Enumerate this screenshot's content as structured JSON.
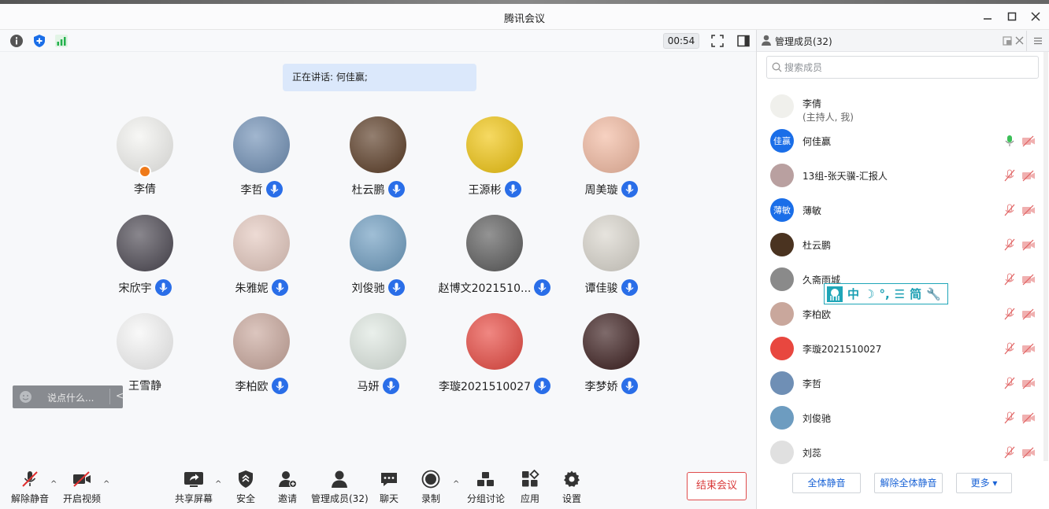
{
  "window": {
    "title": "腾讯会议"
  },
  "meeting": {
    "timer": "00:54",
    "speaking_label": "正在讲话: 何佳赢;"
  },
  "participants": [
    {
      "name": "李倩",
      "mic": false,
      "host": true,
      "avatar_color": "#f3f3f0"
    },
    {
      "name": "李哲",
      "mic": true,
      "avatar_color": "#6f8fb5"
    },
    {
      "name": "杜云鹏",
      "mic": true,
      "avatar_color": "#5a3b24"
    },
    {
      "name": "王源彬",
      "mic": true,
      "avatar_color": "#f1c50e"
    },
    {
      "name": "周美璇",
      "mic": true,
      "avatar_color": "#f2b9a0"
    },
    {
      "name": "宋欣宇",
      "mic": true,
      "avatar_color": "#4a4650"
    },
    {
      "name": "朱雅妮",
      "mic": true,
      "avatar_color": "#e4c8be"
    },
    {
      "name": "刘俊驰",
      "mic": true,
      "avatar_color": "#6d9cc0"
    },
    {
      "name": "赵博文2021510...",
      "mic": true,
      "avatar_color": "#5a5a5a"
    },
    {
      "name": "谭佳骏",
      "mic": true,
      "avatar_color": "#d9d5cc"
    },
    {
      "name": "王雪静",
      "mic": false,
      "avatar_color": "#f6f6f6"
    },
    {
      "name": "李柏欧",
      "mic": true,
      "avatar_color": "#c9a79c"
    },
    {
      "name": "马妍",
      "mic": true,
      "avatar_color": "#dfe8e1"
    },
    {
      "name": "李璇2021510027",
      "mic": true,
      "avatar_color": "#e8473f"
    },
    {
      "name": "李梦娇",
      "mic": true,
      "avatar_color": "#3a1c1c"
    }
  ],
  "chat": {
    "placeholder": "说点什么...",
    "collapse": "<"
  },
  "toolbar": {
    "unmute": "解除静音",
    "start_video": "开启视频",
    "share_screen": "共享屏幕",
    "security": "安全",
    "invite": "邀请",
    "manage_members": "管理成员(32)",
    "chat": "聊天",
    "record": "录制",
    "breakout": "分组讨论",
    "apps": "应用",
    "settings": "设置",
    "end_meeting": "结束会议"
  },
  "panel": {
    "title": "管理成员(32)",
    "search_placeholder": "搜索成员",
    "members": [
      {
        "name": "李倩",
        "sub": "(主持人, 我)",
        "avatar_color": "#f0f0ec",
        "initials": ""
      },
      {
        "name": "何佳赢",
        "avatar_color": "#1a6ee8",
        "initials": "佳赢",
        "mic_active": true
      },
      {
        "name": "13组-张天骥-汇报人",
        "avatar_color": "#b9a0a0",
        "initials": ""
      },
      {
        "name": "薄敏",
        "avatar_color": "#1a6ee8",
        "initials": "薄敏"
      },
      {
        "name": "杜云鹏",
        "avatar_color": "#4a3320",
        "initials": ""
      },
      {
        "name": "久斋雨城",
        "avatar_color": "#8a8a8a",
        "initials": ""
      },
      {
        "name": "李柏欧",
        "avatar_color": "#c9a79c",
        "initials": ""
      },
      {
        "name": "李璇2021510027",
        "avatar_color": "#e8473f",
        "initials": ""
      },
      {
        "name": "李哲",
        "avatar_color": "#6f8fb5",
        "initials": ""
      },
      {
        "name": "刘俊驰",
        "avatar_color": "#6d9cc0",
        "initials": ""
      },
      {
        "name": "刘蕊",
        "avatar_color": "#e0e0e0",
        "initials": ""
      }
    ],
    "mute_all": "全体静音",
    "unmute_all": "解除全体静音",
    "more": "更多 ▾"
  },
  "ime": {
    "items": [
      "中",
      "☽",
      "°,",
      "☰",
      "简",
      "🔧"
    ]
  },
  "colors": {
    "accent": "#2a6ee8",
    "danger": "#e04c4c",
    "mic_green": "#3cbf58"
  }
}
